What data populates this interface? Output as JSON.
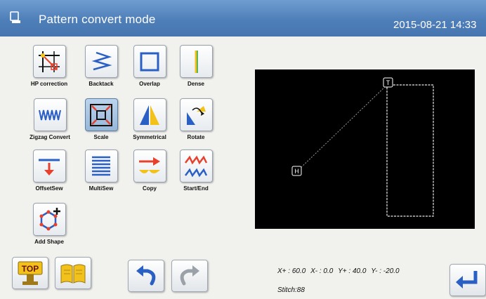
{
  "header": {
    "title": "Pattern convert mode",
    "datetime": "2015-08-21 14:33"
  },
  "tools": {
    "hp_correction": "HP correction",
    "backtack": "Backtack",
    "overlap": "Overlap",
    "dense": "Dense",
    "zigzag_convert": "Zigzag Convert",
    "scale": "Scale",
    "symmetrical": "Symmetrical",
    "rotate": "Rotate",
    "offset_sew": "OffsetSew",
    "multi_sew": "MultiSew",
    "copy": "Copy",
    "start_end": "Start/End",
    "add_shape": "Add Shape"
  },
  "selected_tool": "Scale",
  "preview": {
    "home_marker": "H",
    "top_marker": "T"
  },
  "status": {
    "x_plus": "X+ : 60.0",
    "x_minus": "X- : 0.0",
    "y_plus": "Y+ : 40.0",
    "y_minus": "Y- : -20.0",
    "stitch": "Stitch:88"
  },
  "bottom": {
    "top_label": "TOP"
  },
  "colors": {
    "titlebar": "#4f7fb9",
    "canvas": "#000000",
    "accent_red": "#e8402c",
    "accent_blue": "#2a5fc4"
  }
}
